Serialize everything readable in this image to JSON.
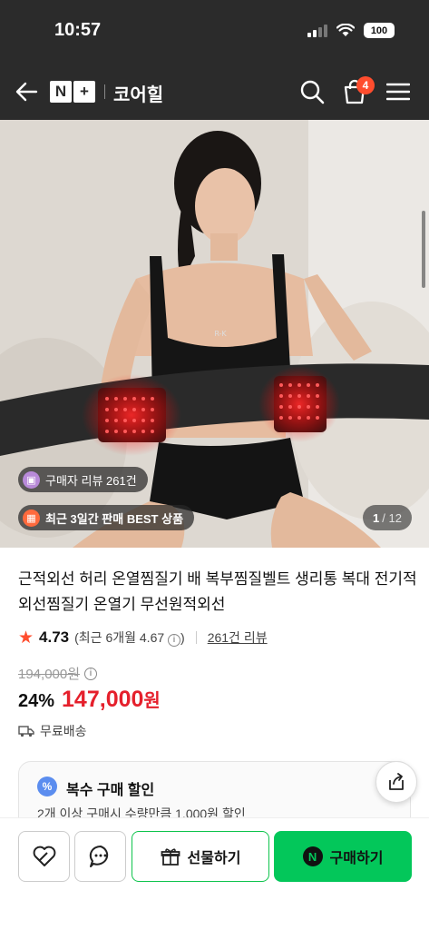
{
  "status_bar": {
    "time": "10:57",
    "battery": "100"
  },
  "nav": {
    "logo_n": "N",
    "logo_plus": "+",
    "store_name": "코어힐",
    "cart_count": "4"
  },
  "hero": {
    "review_chip": "구매자 리뷰 261건",
    "best_chip": "최근 3일간 판매 BEST 상품",
    "image_counter": {
      "current": "1",
      "total": "/ 12"
    }
  },
  "product": {
    "title": "근적외선 허리 온열찜질기 배 복부찜질벨트 생리통 복대 전기적외선찜질기 온열기 무선원적외선",
    "rating": "4.73",
    "recent_rating": "(최근 6개월 4.67",
    "recent_rating_close": ")",
    "review_count": "261건 리뷰",
    "original_price": "194,000원",
    "discount": "24%",
    "price": "147,000",
    "price_unit": "원",
    "shipping": "무료배송"
  },
  "promo": {
    "title": "복수 구매 할인",
    "description": "2개 이상 구매시 수량만큼 1,000원 할인"
  },
  "bottom_bar": {
    "gift_label": "선물하기",
    "buy_label": "구매하기",
    "buy_badge": "N"
  },
  "colors": {
    "header_bg": "#2b2b2b",
    "accent_red": "#e5202c",
    "star_color": "#ff4d2e",
    "naver_green": "#03c75a"
  }
}
